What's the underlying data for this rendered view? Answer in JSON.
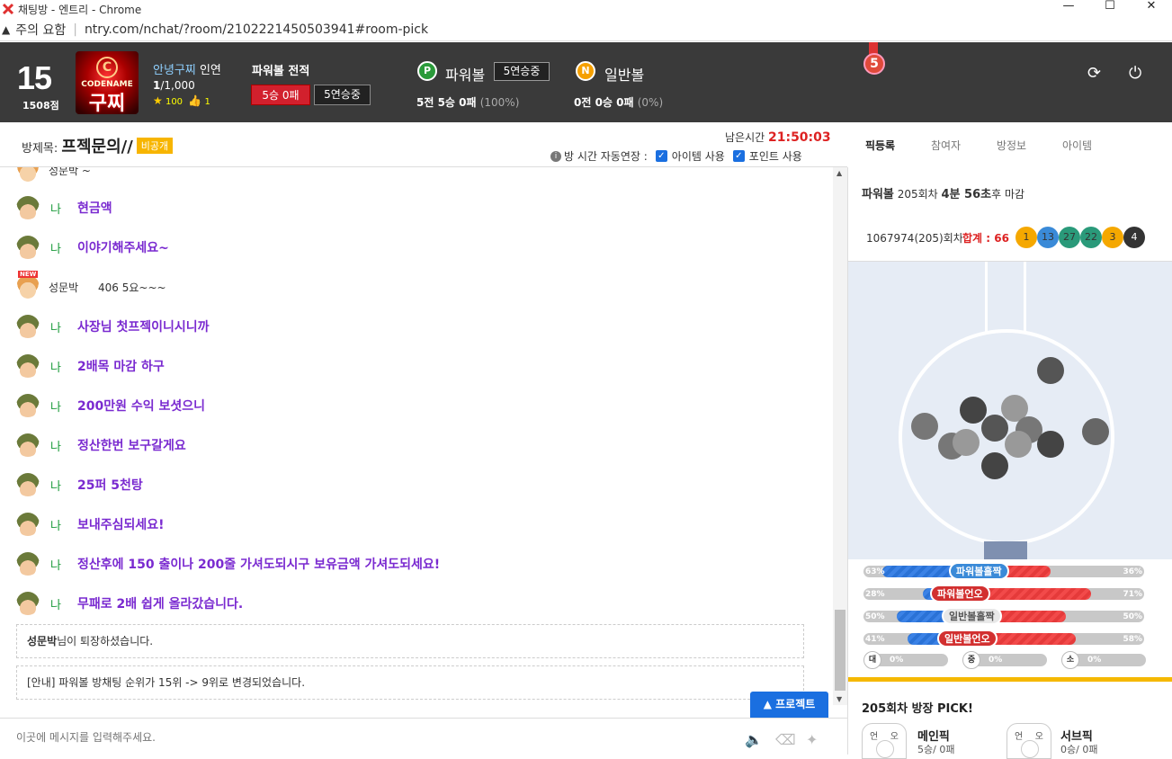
{
  "window": {
    "title": "채팅방 - 엔트리 - Chrome",
    "controls": [
      "—",
      "☐",
      "✕"
    ]
  },
  "address": {
    "warning": "주의 요함",
    "url": "ntry.com/nchat/?room/2102221450503941#room-pick"
  },
  "user": {
    "level": "15",
    "points": "1508점",
    "avatar_top": "CODENAME",
    "avatar_name": "구찌",
    "avatar_emblem": "C",
    "greeting_name": "안녕구찌",
    "greeting_suffix": " 인연",
    "count_bold": "1",
    "count_rest": "/1,000",
    "stars": "100",
    "likes": "1"
  },
  "record": {
    "title": "파워볼 전적",
    "result": "5승 0패",
    "streak": "5연승중"
  },
  "powerball": {
    "badge": "P",
    "label": "파워볼",
    "streak": "5연승중",
    "rec_bold": "5전 5승 0패",
    "rec_pct": "(100%)"
  },
  "normalball": {
    "badge": "N",
    "label": "일반볼",
    "rec_bold": "0전 0승 0패",
    "rec_pct": "(0%)"
  },
  "medal": "5",
  "room": {
    "label": "방제목: ",
    "name": "프젝문의//",
    "tag": "비공개",
    "remain_label": "남은시간 ",
    "remain_time": "21:50:03",
    "info": "i",
    "opt_auto": "방 시간 자동연장 :",
    "opt_item": "아이템 사용",
    "opt_point": "포인트 사용"
  },
  "tabs": [
    "픽등록",
    "참여자",
    "방정보",
    "아이템"
  ],
  "chat": {
    "partial_top": "성문박     ~",
    "messages": [
      {
        "who": "나",
        "text": "현금액",
        "type": "me"
      },
      {
        "who": "나",
        "text": "이야기해주세요~",
        "type": "me"
      },
      {
        "who": "성문박",
        "text": "406 5요~~~",
        "type": "other"
      },
      {
        "who": "나",
        "text": "사장님 첫프젝이니시니까",
        "type": "me"
      },
      {
        "who": "나",
        "text": "2배목 마감 하구",
        "type": "me"
      },
      {
        "who": "나",
        "text": "200만원 수익 보셧으니",
        "type": "me"
      },
      {
        "who": "나",
        "text": "정산한번 보구갈게요",
        "type": "me"
      },
      {
        "who": "나",
        "text": "25퍼 5천탕",
        "type": "me"
      },
      {
        "who": "나",
        "text": "보내주심되세요!",
        "type": "me"
      },
      {
        "who": "나",
        "text": "정산후에 150 출이나 200줄 가셔도되시구 보유금액 가셔도되세요!",
        "type": "me"
      },
      {
        "who": "나",
        "text": "무패로 2배 쉽게 올라갔습니다.",
        "type": "me"
      }
    ],
    "notice1_name": "성문박",
    "notice1_rest": "님이 퇴장하셨습니다.",
    "notice2": "[안내] 파워볼 방채팅 순위가 15위 -> 9위로 변경되었습니다.",
    "project_button": "▲ 프로젝트",
    "input_placeholder": "이곳에 메시지를 입력해주세요."
  },
  "panel": {
    "game": "파워볼",
    "round_info": " 205회차 ",
    "time_bold": "4분 56초",
    "time_rest": "후 마감",
    "last_round": "1067974(205)회차",
    "sum": "합계 : 66",
    "balls": [
      {
        "n": "1",
        "color": "#f5a800"
      },
      {
        "n": "13",
        "color": "#3a8ad8"
      },
      {
        "n": "27",
        "color": "#2a9a7a"
      },
      {
        "n": "22",
        "color": "#2a9a7a"
      },
      {
        "n": "3",
        "color": "#f5a800"
      },
      {
        "n": "4",
        "color": "#333333"
      }
    ],
    "stats": [
      {
        "left": "63%",
        "right": "36%",
        "label": "파워볼홀짝",
        "lv": 63,
        "color": "#3a8ad8"
      },
      {
        "left": "28%",
        "right": "71%",
        "label": "파워볼언오",
        "lv": 28,
        "color": "#d23030"
      },
      {
        "left": "50%",
        "right": "50%",
        "label": "일반볼홀짝",
        "lv": 50,
        "color": "#e8e8e8"
      },
      {
        "left": "41%",
        "right": "58%",
        "label": "일반볼언오",
        "lv": 41,
        "color": "#d23030"
      }
    ],
    "dist": [
      {
        "c": "대",
        "p": "0%"
      },
      {
        "c": "중",
        "p": "0%"
      },
      {
        "c": "소",
        "p": "0%"
      }
    ],
    "pick_head": "205회차 방장 PICK!",
    "main_pick": "메인픽",
    "main_rec": "5승/ 0패",
    "sub_pick": "서브픽",
    "sub_rec": "0승/ 0패",
    "box_l": "언",
    "box_r": "오"
  },
  "colors": {
    "header_bg": "#3a3a3a",
    "accent_blue": "#1a6fe0",
    "chat_purple": "#7a2ad0",
    "me_green": "#1a9a3a",
    "time_red": "#d22222",
    "tag_yellow": "#f7b500"
  }
}
